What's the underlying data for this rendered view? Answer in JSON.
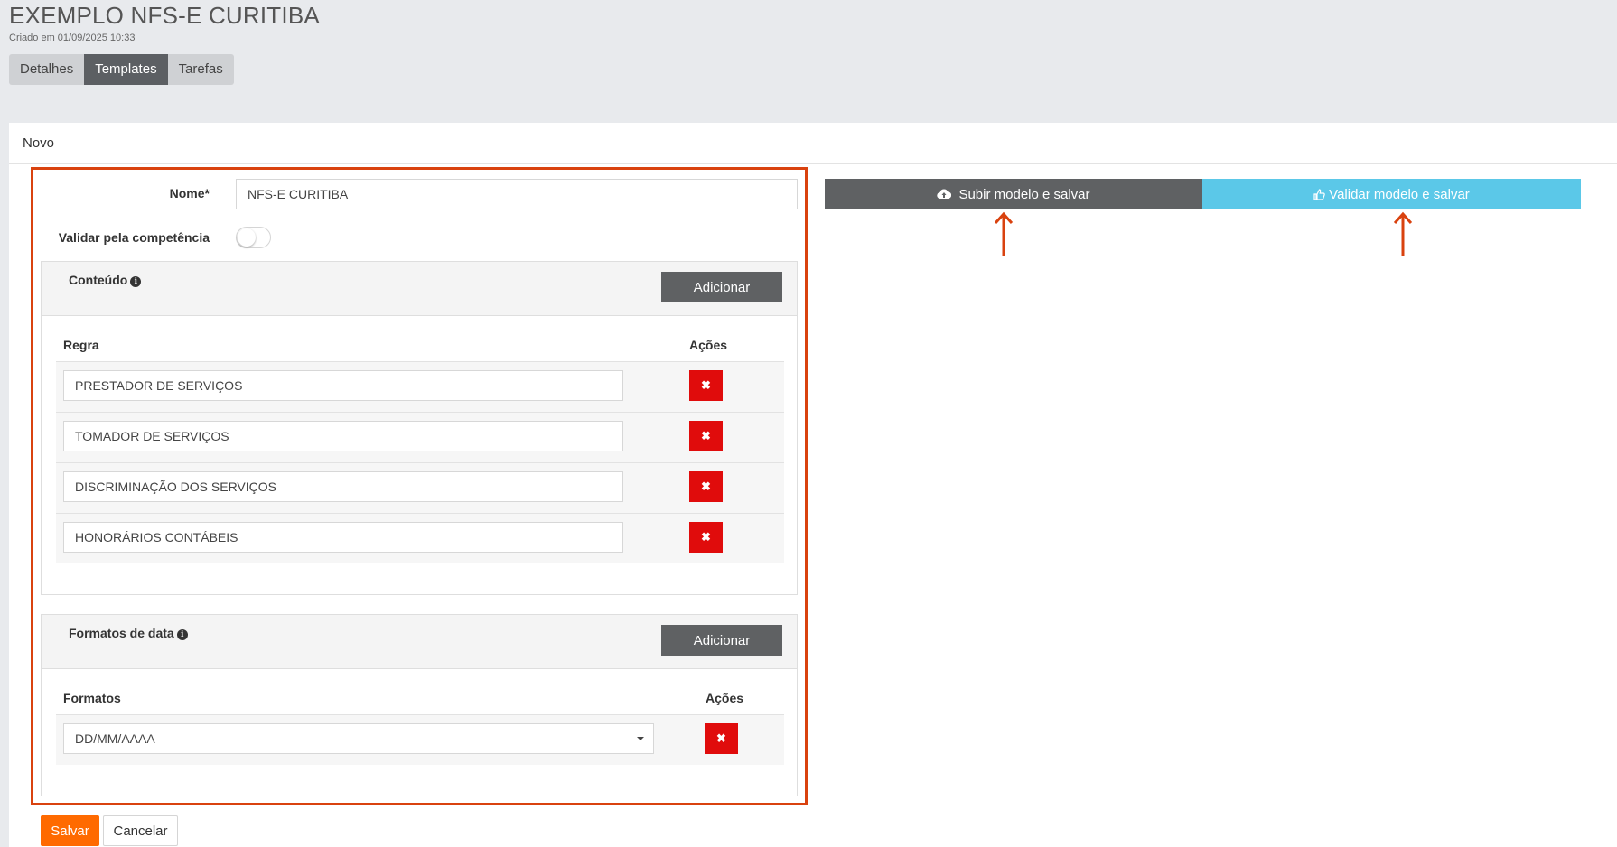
{
  "header": {
    "title": "EXEMPLO NFS-E CURITIBA",
    "subtitle": "Criado em 01/09/2025 10:33"
  },
  "tabs": [
    {
      "label": "Detalhes",
      "active": false
    },
    {
      "label": "Templates",
      "active": true
    },
    {
      "label": "Tarefas",
      "active": false
    }
  ],
  "panel": {
    "title": "Novo"
  },
  "form": {
    "nome_label": "Nome*",
    "nome_value": "NFS-E CURITIBA",
    "validar_label": "Validar pela competência",
    "validar_on": false
  },
  "conteudo": {
    "title": "Conteúdo",
    "add_label": "Adicionar",
    "col_regra": "Regra",
    "col_acoes": "Ações",
    "rows": [
      "PRESTADOR DE SERVIÇOS",
      "TOMADOR DE SERVIÇOS",
      "DISCRIMINAÇÃO DOS SERVIÇOS",
      "HONORÁRIOS CONTÁBEIS"
    ]
  },
  "formatos": {
    "title": "Formatos de data",
    "add_label": "Adicionar",
    "col_formatos": "Formatos",
    "col_acoes": "Ações",
    "selected": "DD/MM/AAAA"
  },
  "actions": {
    "upload_label": "Subir modelo e salvar",
    "validate_label": "Validar modelo e salvar",
    "save_label": "Salvar",
    "cancel_label": "Cancelar"
  },
  "colors": {
    "accent_orange": "#ff6a00",
    "highlight_border": "#d9420f",
    "delete_red": "#e00c0c",
    "validate_blue": "#5bc8e8",
    "dark_button": "#5f6163"
  },
  "icons": {
    "upload": "cloud-upload-icon",
    "validate": "thumbs-up-icon",
    "delete": "close-icon",
    "info": "info-icon",
    "dropdown": "caret-down-icon"
  }
}
